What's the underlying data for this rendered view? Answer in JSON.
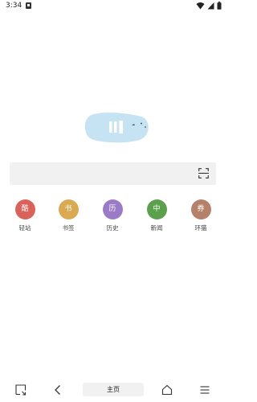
{
  "status_bar": {
    "time": "3:34",
    "icons": [
      "notification-icon",
      "wifi-icon",
      "signal-icon",
      "battery-icon"
    ]
  },
  "search": {
    "placeholder": ""
  },
  "shortcuts": [
    {
      "glyph": "酷",
      "label": "轻站",
      "color": "#d9625a"
    },
    {
      "glyph": "书",
      "label": "书签",
      "color": "#d9aa52"
    },
    {
      "glyph": "历",
      "label": "历史",
      "color": "#9b7bc8"
    },
    {
      "glyph": "中",
      "label": "新闻",
      "color": "#5ba04d"
    },
    {
      "glyph": "券",
      "label": "环猫",
      "color": "#b5816a"
    }
  ],
  "bottom_nav": {
    "home_label": "主页",
    "icons": [
      "tab-switch-icon",
      "back-icon",
      "home-icon",
      "menu-icon"
    ]
  },
  "colors": {
    "logo_blob": "#c5e3f3",
    "search_bg": "#f1f1f1"
  }
}
